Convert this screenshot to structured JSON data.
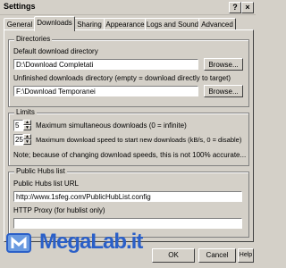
{
  "window": {
    "title": "Settings"
  },
  "tabs": [
    {
      "label": "General"
    },
    {
      "label": "Downloads"
    },
    {
      "label": "Sharing"
    },
    {
      "label": "Appearance"
    },
    {
      "label": "Logs and Sound"
    },
    {
      "label": "Advanced"
    }
  ],
  "directories": {
    "title": "Directories",
    "default_label": "Default download directory",
    "default_value": "D:\\Download Completati",
    "unfinished_label": "Unfinished downloads directory (empty = download directly to target)",
    "unfinished_value": "F:\\Download Temporanei",
    "browse_label": "Browse..."
  },
  "limits": {
    "title": "Limits",
    "max_sim_value": "5",
    "max_sim_label": "Maximum simultaneous downloads (0 = infinite)",
    "max_speed_value": "25",
    "max_speed_label": "Maximum download speed to start new downloads (kB/s, 0 = disable)",
    "note": "Note; because of changing download speeds, this is not 100% accurate..."
  },
  "hublist": {
    "title": "Public Hubs list",
    "url_label": "Public Hubs list URL",
    "url_value": "http://www.1sfeg.com/PublicHubList.config",
    "proxy_label": "HTTP Proxy (for hublist only)",
    "proxy_value": ""
  },
  "watermark": {
    "text": "MegaLab.it"
  },
  "buttons": {
    "ok": "OK",
    "cancel": "Cancel",
    "help": "Help"
  }
}
